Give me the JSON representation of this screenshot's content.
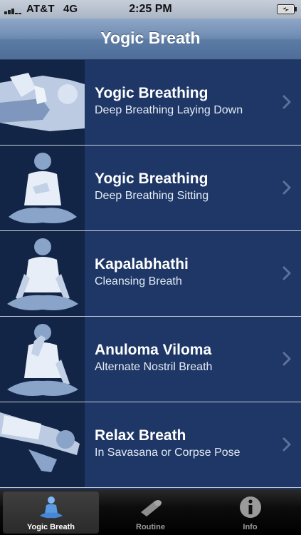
{
  "status_bar": {
    "carrier": "AT&T",
    "network": "4G",
    "time": "2:25 PM"
  },
  "nav": {
    "title": "Yogic Breath"
  },
  "exercises": [
    {
      "title": "Yogic Breathing",
      "subtitle": "Deep Breathing Laying Down",
      "pose": "lying-down"
    },
    {
      "title": "Yogic Breathing",
      "subtitle": "Deep Breathing Sitting",
      "pose": "sitting-hands-on-chest"
    },
    {
      "title": "Kapalabhathi",
      "subtitle": "Cleansing Breath",
      "pose": "sitting-meditation"
    },
    {
      "title": "Anuloma Viloma",
      "subtitle": "Alternate Nostril Breath",
      "pose": "sitting-nostril"
    },
    {
      "title": "Relax Breath",
      "subtitle": "In Savasana or Corpse Pose",
      "pose": "corpse-pose"
    }
  ],
  "tabs": [
    {
      "label": "Yogic Breath",
      "icon": "meditation-figure-icon",
      "selected": true
    },
    {
      "label": "Routine",
      "icon": "yoga-mat-icon",
      "selected": false
    },
    {
      "label": "Info",
      "icon": "info-icon",
      "selected": false
    }
  ],
  "colors": {
    "list_background": "#1e3766",
    "thumbnail_background": "#122546",
    "nav_bar": "#6d8bb2",
    "tab_active_icon": "#6fa8e8"
  }
}
